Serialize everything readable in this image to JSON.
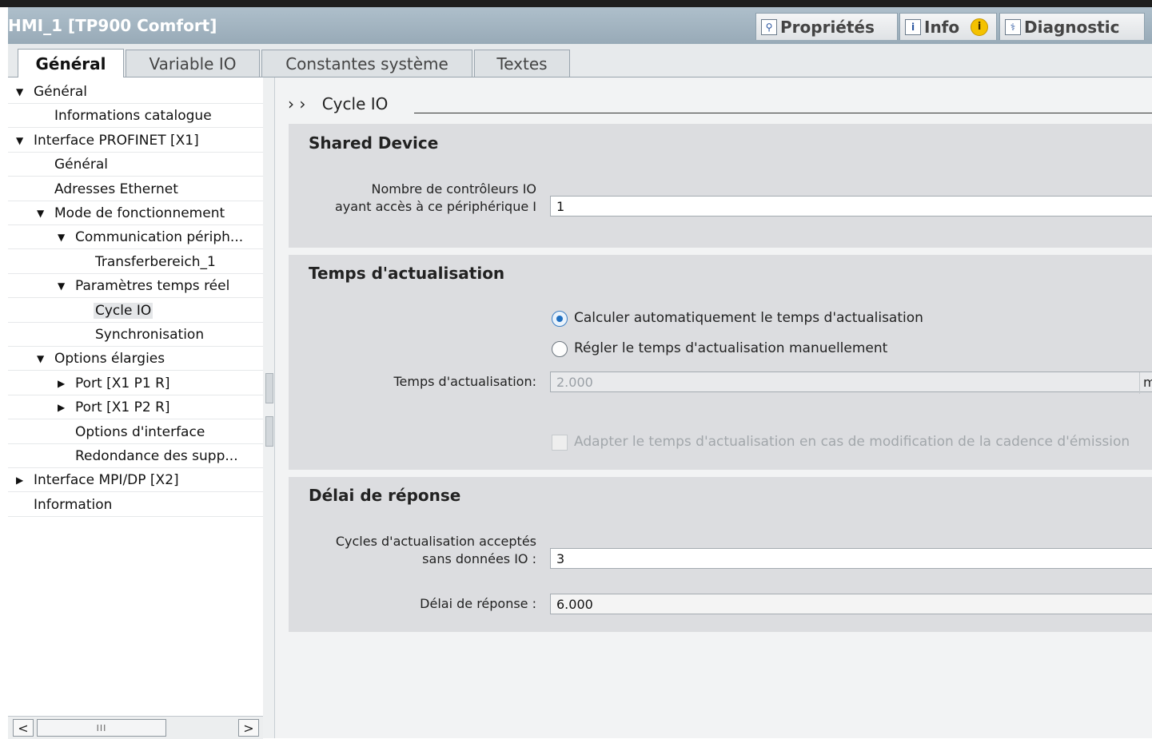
{
  "window": {
    "title": "HMI_1 [TP900 Comfort]"
  },
  "inspector_tabs": [
    {
      "label": "Propriétés",
      "icon": "properties-icon"
    },
    {
      "label": "Info",
      "icon": "info-icon"
    },
    {
      "label": "Diagnostic",
      "icon": "diagnostic-icon"
    }
  ],
  "tabs": [
    {
      "label": "Général",
      "active": true
    },
    {
      "label": "Variable IO",
      "active": false
    },
    {
      "label": "Constantes système",
      "active": false
    },
    {
      "label": "Textes",
      "active": false
    }
  ],
  "tree": [
    {
      "label": "Général",
      "expand": "expanded",
      "level": 0
    },
    {
      "label": "Informations catalogue",
      "expand": "none",
      "level": 1
    },
    {
      "label": "Interface PROFINET [X1]",
      "expand": "expanded",
      "level": 0
    },
    {
      "label": "Général",
      "expand": "none",
      "level": 1
    },
    {
      "label": "Adresses Ethernet",
      "expand": "none",
      "level": 1
    },
    {
      "label": "Mode de fonctionnement",
      "expand": "expanded",
      "level": 1
    },
    {
      "label": "Communication périph...",
      "expand": "expanded",
      "level": 2
    },
    {
      "label": "Transferbereich_1",
      "expand": "none",
      "level": 3
    },
    {
      "label": "Paramètres temps réel",
      "expand": "expanded",
      "level": 2
    },
    {
      "label": "Cycle IO",
      "expand": "none",
      "level": 3,
      "selected": true
    },
    {
      "label": "Synchronisation",
      "expand": "none",
      "level": 3
    },
    {
      "label": "Options élargies",
      "expand": "expanded",
      "level": 1
    },
    {
      "label": "Port [X1 P1 R]",
      "expand": "collapsed",
      "level": 2
    },
    {
      "label": "Port [X1 P2 R]",
      "expand": "collapsed",
      "level": 2
    },
    {
      "label": "Options d'interface",
      "expand": "none",
      "level": 2
    },
    {
      "label": "Redondance des supp...",
      "expand": "none",
      "level": 2
    },
    {
      "label": "Interface MPI/DP [X2]",
      "expand": "collapsed",
      "level": 0
    },
    {
      "label": "Information",
      "expand": "none",
      "level": 0
    }
  ],
  "breadcrumb": {
    "arrows": "› ›",
    "title": "Cycle IO"
  },
  "shared_device": {
    "title": "Shared Device",
    "controllers_label_line1": "Nombre de contrôleurs IO",
    "controllers_label_line2": "ayant accès à ce périphérique I",
    "controllers_value": "1"
  },
  "update_time": {
    "title": "Temps d'actualisation",
    "option_auto": "Calculer automatiquement le temps d'actualisation",
    "option_manual": "Régler le temps d'actualisation manuellement",
    "selected_option": "auto",
    "time_label": "Temps d'actualisation:",
    "time_value": "2.000",
    "time_unit": "m",
    "adapt_label": "Adapter le temps d'actualisation en cas de modification de la cadence d'émission",
    "adapt_checked": false
  },
  "watchdog": {
    "title": "Délai de réponse",
    "cycles_label_line1": "Cycles d'actualisation acceptés",
    "cycles_label_line2": "sans données IO :",
    "cycles_value": "3",
    "delay_label": "Délai de réponse :",
    "delay_value": "6.000"
  },
  "scrollbar": {
    "left": "<",
    "right": ">",
    "thumb": "III"
  },
  "colors": {
    "accent": "#1f6fc1",
    "title_bar": "#a3b4c0",
    "section_bg": "#dcdde0"
  }
}
